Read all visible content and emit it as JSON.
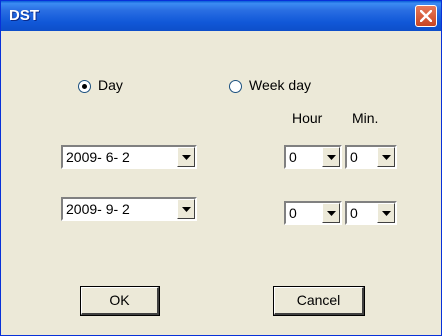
{
  "window": {
    "title": "DST"
  },
  "mode": {
    "day_label": "Day",
    "week_label": "Week day",
    "selected": "day"
  },
  "headers": {
    "hour": "Hour",
    "min": "Min."
  },
  "start": {
    "date": "2009- 6- 2",
    "hour": "0",
    "min": "0"
  },
  "end": {
    "date": "2009- 9- 2",
    "hour": "0",
    "min": "0"
  },
  "buttons": {
    "ok": "OK",
    "cancel": "Cancel"
  },
  "icons": {
    "close": "close-icon",
    "dropdown": "chevron-down-icon"
  }
}
